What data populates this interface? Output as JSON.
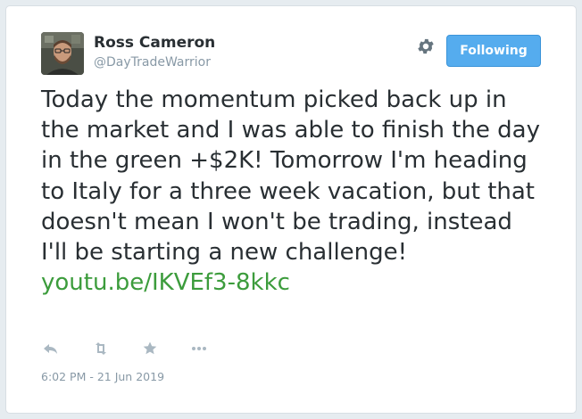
{
  "author": {
    "display_name": "Ross Cameron",
    "handle": "@DayTradeWarrior"
  },
  "header": {
    "settings_icon": "gear-icon",
    "follow_label": "Following"
  },
  "tweet": {
    "text": "Today the momentum picked back up in the market and I was able to finish the day in the green +$2K! Tomorrow I'm heading to Italy for a three week vacation, but that doesn't mean I won't be trading, instead I'll be starting a new challenge!",
    "link": "youtu.be/IKVEf3-8kkc",
    "timestamp": "6:02 PM - 21 Jun 2019"
  },
  "actions": [
    {
      "name": "reply-icon"
    },
    {
      "name": "retweet-icon"
    },
    {
      "name": "like-star-icon"
    },
    {
      "name": "more-icon"
    }
  ],
  "colors": {
    "follow_button": "#55acee",
    "link": "#3c9c3c",
    "secondary_text": "#8899a6",
    "primary_text": "#292f33",
    "icon": "#aab8c2"
  }
}
